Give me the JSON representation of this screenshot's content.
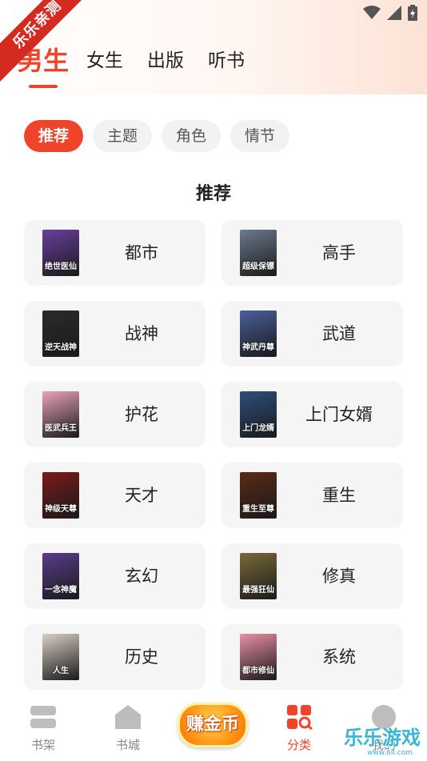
{
  "watermark_ribbon": "乐乐亲测",
  "gender_tabs": [
    {
      "label": "男生"
    },
    {
      "label": "女生"
    },
    {
      "label": "出版"
    },
    {
      "label": "听书"
    }
  ],
  "chips": [
    {
      "label": "推荐"
    },
    {
      "label": "主题"
    },
    {
      "label": "角色"
    },
    {
      "label": "情节"
    }
  ],
  "section_title": "推荐",
  "categories": [
    {
      "label": "都市",
      "cover_color": "#6a3ea1",
      "cover_text": "绝世医仙"
    },
    {
      "label": "高手",
      "cover_color": "#6b7a8e",
      "cover_text": "超级保镖"
    },
    {
      "label": "战神",
      "cover_color": "#2b2b2b",
      "cover_text": "逆天战神"
    },
    {
      "label": "武道",
      "cover_color": "#4a5f9c",
      "cover_text": "神武丹尊"
    },
    {
      "label": "护花",
      "cover_color": "#e9a2b6",
      "cover_text": "医武兵王"
    },
    {
      "label": "上门女婿",
      "cover_color": "#2d4f7a",
      "cover_text": "上门龙婿"
    },
    {
      "label": "天才",
      "cover_color": "#7a1a1a",
      "cover_text": "神级天尊"
    },
    {
      "label": "重生",
      "cover_color": "#5a2a16",
      "cover_text": "重生至尊"
    },
    {
      "label": "玄幻",
      "cover_color": "#5a3c8a",
      "cover_text": "一念神魔"
    },
    {
      "label": "修真",
      "cover_color": "#7a6a3a",
      "cover_text": "最强狂仙"
    },
    {
      "label": "历史",
      "cover_color": "#d8d0c4",
      "cover_text": "人生"
    },
    {
      "label": "系统",
      "cover_color": "#e88fa6",
      "cover_text": "都市修仙"
    }
  ],
  "bottom_nav": {
    "bookshelf": "书架",
    "bookstore": "书城",
    "earn": "赚金币",
    "category": "分类",
    "profile": "我的"
  },
  "site_watermark": "乐乐游戏",
  "site_watermark_sub": "www.6ll.com",
  "colors": {
    "accent": "#f0442a",
    "chip_bg": "#f2f2f2",
    "card_bg": "#f5f5f5"
  }
}
